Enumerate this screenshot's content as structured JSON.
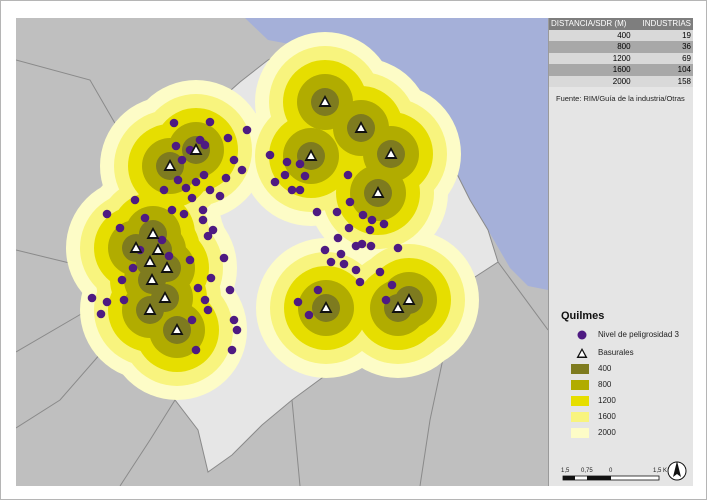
{
  "map": {
    "colors": {
      "river": "#a5b0d9",
      "land_outer": "#bfbfbf",
      "district": "#e6e6e6",
      "border": "#8a8a8a",
      "buffer_2000": "#fdfcc7",
      "buffer_1600": "#f8f47e",
      "buffer_1200": "#e6de00",
      "buffer_800": "#b1ac00",
      "buffer_400": "#7e7b1f",
      "industry_dot": "#4e1a82"
    },
    "buffer_distances_m": [
      2000,
      1600,
      1200,
      800,
      400
    ],
    "basurales": [
      [
        170,
        166
      ],
      [
        196,
        150
      ],
      [
        153,
        234
      ],
      [
        136,
        248
      ],
      [
        158,
        250
      ],
      [
        150,
        262
      ],
      [
        167,
        268
      ],
      [
        152,
        280
      ],
      [
        165,
        298
      ],
      [
        150,
        310
      ],
      [
        177,
        330
      ],
      [
        325,
        102
      ],
      [
        361,
        128
      ],
      [
        391,
        154
      ],
      [
        311,
        156
      ],
      [
        378,
        193
      ],
      [
        326,
        308
      ],
      [
        398,
        308
      ],
      [
        409,
        300
      ]
    ],
    "industrias": [
      [
        174,
        123
      ],
      [
        210,
        122
      ],
      [
        228,
        138
      ],
      [
        247,
        130
      ],
      [
        200,
        140
      ],
      [
        176,
        146
      ],
      [
        182,
        160
      ],
      [
        190,
        150
      ],
      [
        205,
        145
      ],
      [
        234,
        160
      ],
      [
        242,
        170
      ],
      [
        178,
        180
      ],
      [
        164,
        190
      ],
      [
        204,
        175
      ],
      [
        186,
        188
      ],
      [
        196,
        182
      ],
      [
        192,
        198
      ],
      [
        203,
        210
      ],
      [
        220,
        196
      ],
      [
        210,
        190
      ],
      [
        172,
        210
      ],
      [
        184,
        214
      ],
      [
        203,
        220
      ],
      [
        208,
        236
      ],
      [
        213,
        230
      ],
      [
        107,
        214
      ],
      [
        135,
        200
      ],
      [
        120,
        228
      ],
      [
        145,
        218
      ],
      [
        133,
        268
      ],
      [
        140,
        250
      ],
      [
        162,
        240
      ],
      [
        169,
        256
      ],
      [
        190,
        260
      ],
      [
        224,
        258
      ],
      [
        211,
        278
      ],
      [
        198,
        288
      ],
      [
        205,
        300
      ],
      [
        192,
        320
      ],
      [
        208,
        310
      ],
      [
        234,
        320
      ],
      [
        237,
        330
      ],
      [
        232,
        350
      ],
      [
        196,
        350
      ],
      [
        92,
        298
      ],
      [
        107,
        302
      ],
      [
        101,
        314
      ],
      [
        124,
        300
      ],
      [
        122,
        280
      ],
      [
        230,
        290
      ],
      [
        270,
        155
      ],
      [
        287,
        162
      ],
      [
        275,
        182
      ],
      [
        292,
        190
      ],
      [
        305,
        176
      ],
      [
        300,
        190
      ],
      [
        317,
        212
      ],
      [
        337,
        212
      ],
      [
        350,
        202
      ],
      [
        363,
        215
      ],
      [
        372,
        220
      ],
      [
        384,
        224
      ],
      [
        370,
        230
      ],
      [
        349,
        228
      ],
      [
        338,
        238
      ],
      [
        325,
        250
      ],
      [
        341,
        254
      ],
      [
        356,
        246
      ],
      [
        371,
        246
      ],
      [
        362,
        244
      ],
      [
        331,
        262
      ],
      [
        344,
        264
      ],
      [
        356,
        270
      ],
      [
        360,
        282
      ],
      [
        380,
        272
      ],
      [
        398,
        248
      ],
      [
        298,
        302
      ],
      [
        309,
        315
      ],
      [
        318,
        290
      ],
      [
        386,
        300
      ],
      [
        392,
        285
      ],
      [
        300,
        164
      ],
      [
        285,
        175
      ],
      [
        226,
        178
      ],
      [
        348,
        175
      ]
    ]
  },
  "table": {
    "headers": [
      "DISTANCIA/SDR (M)",
      "INDUSTRIAS"
    ],
    "rows": [
      [
        "400",
        "19"
      ],
      [
        "800",
        "36"
      ],
      [
        "1200",
        "69"
      ],
      [
        "1600",
        "104"
      ],
      [
        "2000",
        "158"
      ]
    ]
  },
  "source": "Fuente: RIM/Guía de la industria/Otras",
  "legend": {
    "title": "Quilmes",
    "items": [
      {
        "label": "Nivel de peligrosidad 3",
        "symbol": "industry-dot"
      },
      {
        "label": "Basurales",
        "symbol": "triangle"
      },
      {
        "label": "400",
        "color": "#7e7b1f"
      },
      {
        "label": "800",
        "color": "#b1ac00"
      },
      {
        "label": "1200",
        "color": "#e6de00"
      },
      {
        "label": "1600",
        "color": "#f8f47e"
      },
      {
        "label": "2000",
        "color": "#fdfcc7"
      }
    ]
  },
  "scale": {
    "ticks": [
      "1,5",
      "0,75",
      "0",
      "1,5 K"
    ]
  },
  "north_arrow": "north-arrow-icon"
}
